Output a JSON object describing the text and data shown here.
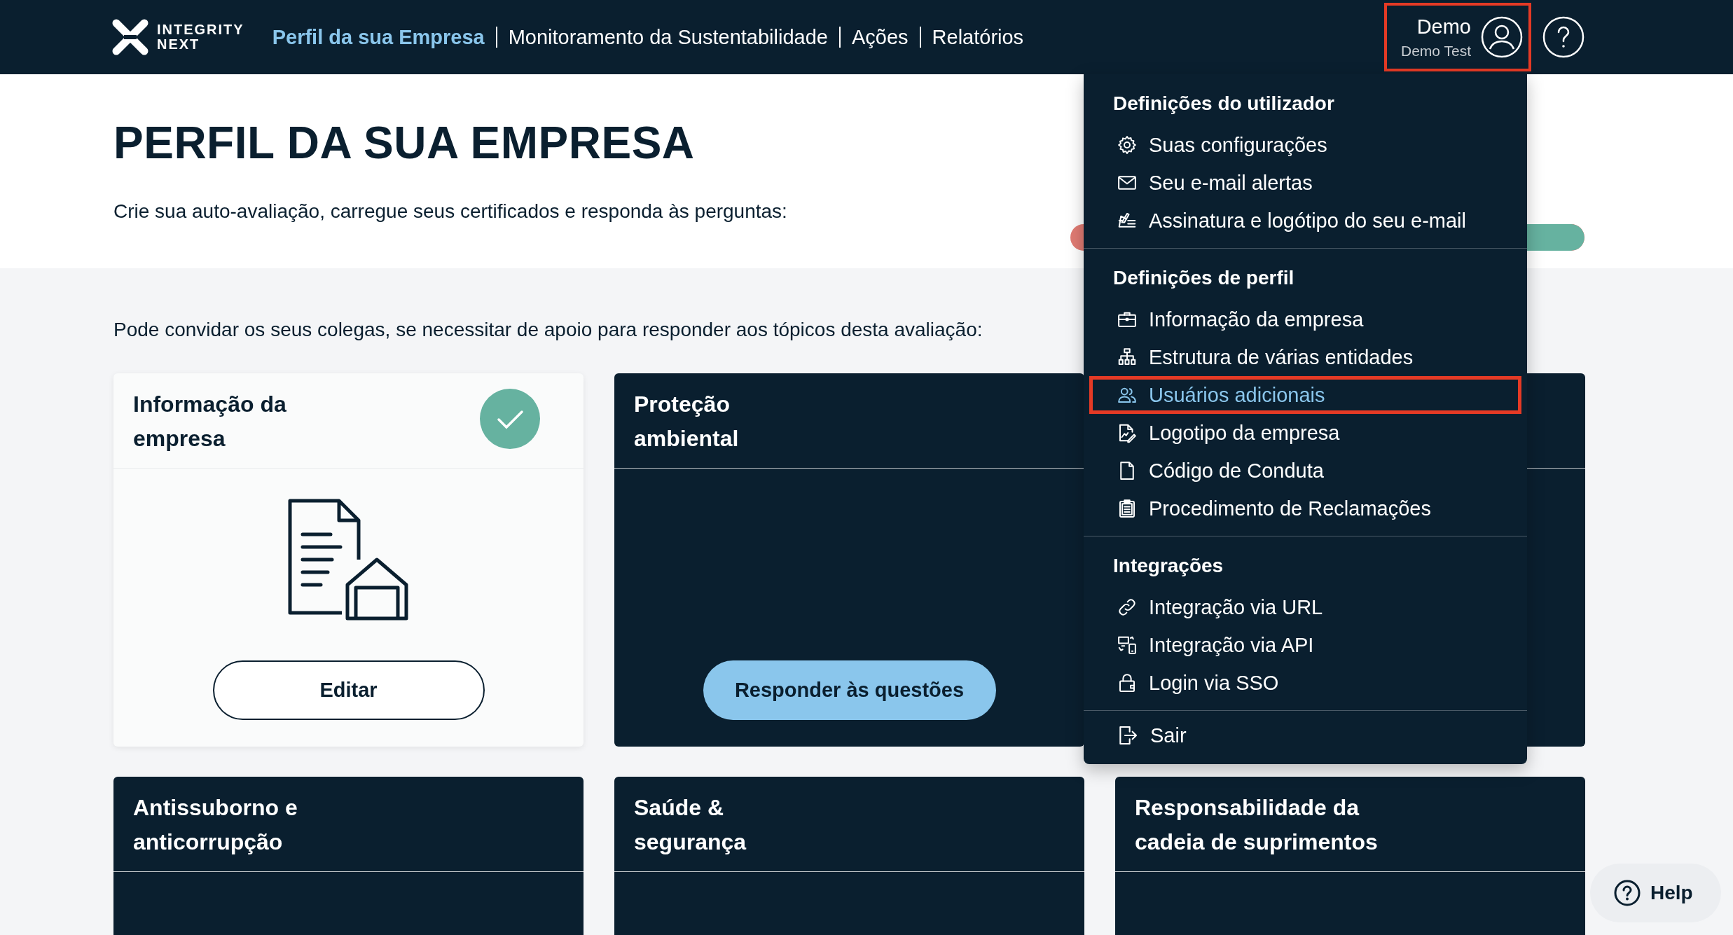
{
  "header": {
    "logo": [
      "INTEGRITY",
      "NEXT"
    ],
    "nav": [
      {
        "label": "Perfil da sua Empresa",
        "selected": true
      },
      {
        "label": "Monitoramento da Sustentabilidade",
        "selected": false
      },
      {
        "label": "Ações",
        "selected": false
      },
      {
        "label": "Relatórios",
        "selected": false
      }
    ],
    "user": {
      "name": "Demo",
      "company": "Demo Test",
      "highlighted": true
    }
  },
  "intro": {
    "title": "PERFIL DA SUA EMPRESA",
    "progress": {
      "level": 1
    },
    "subtitle": "Crie sua auto-avaliação, carregue seus certificados e responda às perguntas:"
  },
  "invite": "Pode convidar os seus colegas, se necessitar de apoio para responder aos tópicos desta avaliação:",
  "cards": [
    {
      "kind": "light",
      "title": "Informação da\nempresa",
      "done": true,
      "button": "Editar"
    },
    {
      "kind": "dark",
      "title": "Proteção\nambiental",
      "done": false,
      "button": "Responder às questões"
    },
    {
      "kind": "dark",
      "done": false
    },
    {
      "kind": "dark",
      "title": "Antissuborno e\nanticorrupção",
      "done": false
    },
    {
      "kind": "dark",
      "title": "Saúde &\nsegurança",
      "done": false
    },
    {
      "kind": "dark",
      "title": "Responsabilidade da\ncadeia de suprimentos",
      "done": false
    }
  ],
  "user_menu": {
    "sections": [
      {
        "heading": "Definições do utilizador",
        "items": [
          {
            "label": "Suas configurações",
            "selected": false,
            "highlighted": false
          },
          {
            "label": "Seu e-mail alertas",
            "selected": false,
            "highlighted": false
          },
          {
            "label": "Assinatura e logótipo do seu e-mail",
            "selected": false,
            "highlighted": false
          }
        ]
      },
      {
        "heading": "Definições de perfil",
        "items": [
          {
            "label": "Informação da empresa",
            "selected": false,
            "highlighted": false
          },
          {
            "label": "Estrutura de várias entidades",
            "selected": false,
            "highlighted": false
          },
          {
            "label": "Usuários adicionais",
            "selected": true,
            "highlighted": true
          },
          {
            "label": "Logotipo da empresa",
            "selected": false,
            "highlighted": false
          },
          {
            "label": "Código de Conduta",
            "selected": false,
            "highlighted": false
          },
          {
            "label": "Procedimento de Reclamações",
            "selected": false,
            "highlighted": false
          }
        ]
      },
      {
        "heading": "Integrações",
        "items": [
          {
            "label": "Integração via URL",
            "selected": false,
            "highlighted": false
          },
          {
            "label": "Integração via API",
            "selected": false,
            "highlighted": false
          },
          {
            "label": "Login via SSO",
            "selected": false,
            "highlighted": false
          }
        ]
      }
    ],
    "logout": "Sair"
  },
  "help_button": "Help"
}
